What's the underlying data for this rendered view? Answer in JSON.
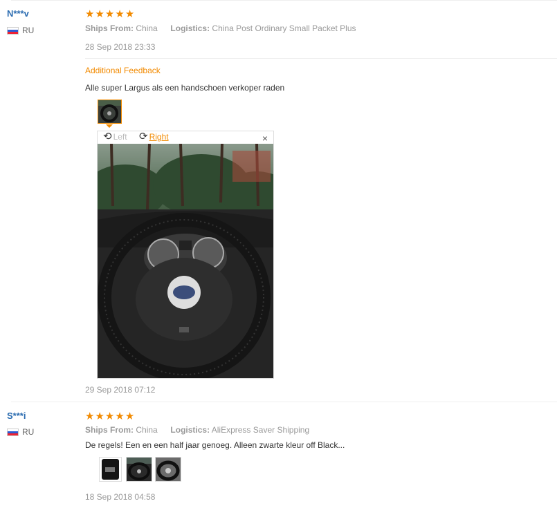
{
  "reviews": [
    {
      "user": "N***v",
      "country": "RU",
      "rating": 5,
      "ships_from_label": "Ships From:",
      "ships_from": "China",
      "logistics_label": "Logistics:",
      "logistics": "China Post Ordinary Small Packet Plus",
      "date": "28 Sep 2018 23:33",
      "additional_feedback_label": "Additional Feedback",
      "additional_text": "Alle super Largus als een handschoen verkoper raden",
      "viewer": {
        "rotate_left": "Left",
        "rotate_right": "Right",
        "close": "×"
      },
      "additional_date": "29 Sep 2018 07:12"
    },
    {
      "user": "S***i",
      "country": "RU",
      "rating": 5,
      "ships_from_label": "Ships From:",
      "ships_from": "China",
      "logistics_label": "Logistics:",
      "logistics": "AliExpress Saver Shipping",
      "text": "De regels! Een en een half jaar genoeg. Alleen zwarte kleur off Black...",
      "date": "18 Sep 2018 04:58"
    }
  ],
  "star_glyph": "★",
  "icons": {
    "rotate_left": "rotate-left-icon",
    "rotate_right": "rotate-right-icon",
    "close": "close-icon"
  },
  "colors": {
    "accent": "#f28a00",
    "user": "#2b6cb0",
    "muted": "#999999"
  }
}
